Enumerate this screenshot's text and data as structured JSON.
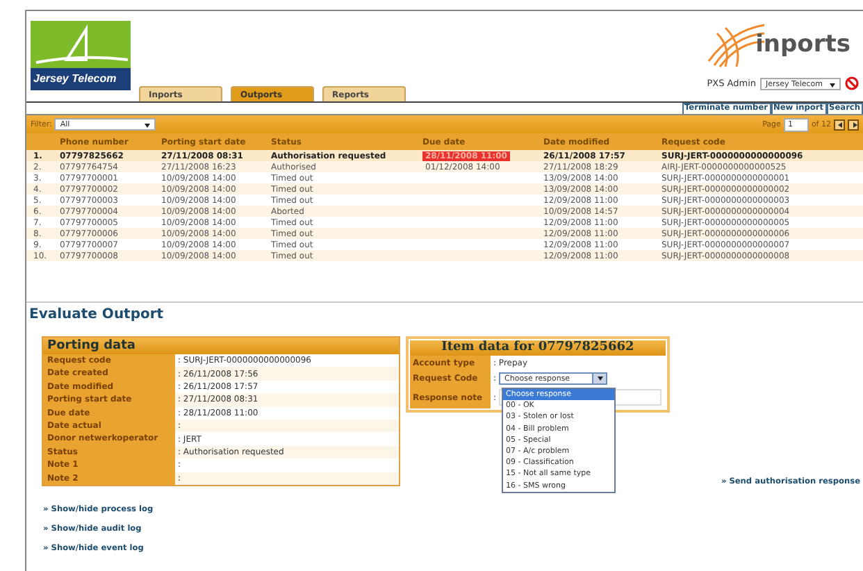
{
  "header": {
    "logo_text": "Jersey Telecom",
    "brand": "inports",
    "tabs": [
      {
        "label": "Inports",
        "selected": false
      },
      {
        "label": "Outports",
        "selected": true
      },
      {
        "label": "Reports",
        "selected": false
      }
    ],
    "user": "PXS Admin",
    "operator_select": "Jersey Telecom",
    "actions": [
      "Terminate number",
      "New inport",
      "Search"
    ]
  },
  "filter": {
    "label": "Filter:",
    "value": "All",
    "page_label": "Page",
    "page": "1",
    "page_of": "of 12"
  },
  "table": {
    "columns": [
      "Phone number",
      "Porting start date",
      "Status",
      "Due date",
      "Date modified",
      "Request code"
    ],
    "rows": [
      {
        "index": "1.",
        "phone": "07797825662",
        "start": "27/11/2008 08:31",
        "status": "Authorisation requested",
        "due": "28/11/2008 11:00",
        "overdue": true,
        "modified": "26/11/2008 17:57",
        "code": "SURJ-JERT-0000000000000096",
        "selected": true
      },
      {
        "index": "2.",
        "phone": "07797764754",
        "start": "27/11/2008 16:23",
        "status": "Authorised",
        "due": "01/12/2008 14:00",
        "overdue": false,
        "modified": "27/11/2008 18:29",
        "code": "AIRJ-JERT-0000000000000525",
        "selected": false
      },
      {
        "index": "3.",
        "phone": "07797700001",
        "start": "10/09/2008 14:00",
        "status": "Timed out",
        "modified": "13/09/2008 14:00",
        "code": "SURJ-JERT-0000000000000001",
        "selected": false
      },
      {
        "index": "4.",
        "phone": "07797700002",
        "start": "10/09/2008 14:00",
        "status": "Timed out",
        "modified": "13/09/2008 14:00",
        "code": "SURJ-JERT-0000000000000002",
        "selected": false
      },
      {
        "index": "5.",
        "phone": "07797700003",
        "start": "10/09/2008 14:00",
        "status": "Timed out",
        "modified": "12/09/2008 11:00",
        "code": "SURJ-JERT-0000000000000003",
        "selected": false
      },
      {
        "index": "6.",
        "phone": "07797700004",
        "start": "10/09/2008 14:00",
        "status": "Aborted",
        "modified": "10/09/2008 14:57",
        "code": "SURJ-JERT-0000000000000004",
        "selected": false
      },
      {
        "index": "7.",
        "phone": "07797700005",
        "start": "10/09/2008 14:00",
        "status": "Timed out",
        "modified": "12/09/2008 11:00",
        "code": "SURJ-JERT-0000000000000005",
        "selected": false
      },
      {
        "index": "8.",
        "phone": "07797700006",
        "start": "10/09/2008 14:00",
        "status": "Timed out",
        "modified": "12/09/2008 11:00",
        "code": "SURJ-JERT-0000000000000006",
        "selected": false
      },
      {
        "index": "9.",
        "phone": "07797700007",
        "start": "10/09/2008 14:00",
        "status": "Timed out",
        "modified": "12/09/2008 11:00",
        "code": "SURJ-JERT-0000000000000007",
        "selected": false
      },
      {
        "index": "10.",
        "phone": "07797700008",
        "start": "10/09/2008 14:00",
        "status": "Timed out",
        "modified": "12/09/2008 11:00",
        "code": "SURJ-JERT-0000000000000008",
        "selected": false
      }
    ]
  },
  "section_title": "Evaluate Outport",
  "porting_data": {
    "title": "Porting data",
    "rows": [
      {
        "label": "Request code",
        "value": ": SURJ-JERT-0000000000000096"
      },
      {
        "label": "Date created",
        "value": ": 26/11/2008 17:56"
      },
      {
        "label": "Date modified",
        "value": ": 26/11/2008 17:57"
      },
      {
        "label": "Porting start date",
        "value": ": 27/11/2008 08:31"
      },
      {
        "label": "Due date",
        "value": ": 28/11/2008 11:00"
      },
      {
        "label": "Date actual",
        "value": ":"
      },
      {
        "label": "Donor netwerkoperator",
        "value": ": JERT"
      },
      {
        "label": "Status",
        "value": ": Authorisation requested"
      },
      {
        "label": "Note 1",
        "value": ":"
      },
      {
        "label": "Note 2",
        "value": ":"
      }
    ]
  },
  "item_data": {
    "title": "Item data for 07797825662",
    "account_label": "Account type",
    "account_value": ": Prepay",
    "request_label": "Request Code",
    "request_sep": ":",
    "request_value": "Choose response",
    "note_label": "Response note",
    "note_sep": ":",
    "options": [
      {
        "label": "Choose response",
        "selected": true
      },
      {
        "label": "00 - OK",
        "selected": false
      },
      {
        "label": "03 - Stolen or lost",
        "selected": false
      },
      {
        "label": "04 - Bill problem",
        "selected": false
      },
      {
        "label": "05 - Special",
        "selected": false
      },
      {
        "label": "07 - A/c problem",
        "selected": false
      },
      {
        "label": "09 - Classification",
        "selected": false
      },
      {
        "label": "15 - Not all same type",
        "selected": false
      },
      {
        "label": "16 - SMS wrong",
        "selected": false
      }
    ]
  },
  "send_link": "» Send authorisation response",
  "log_links": [
    "» Show/hide process log",
    "» Show/hide audit log",
    "» Show/hide event log"
  ]
}
